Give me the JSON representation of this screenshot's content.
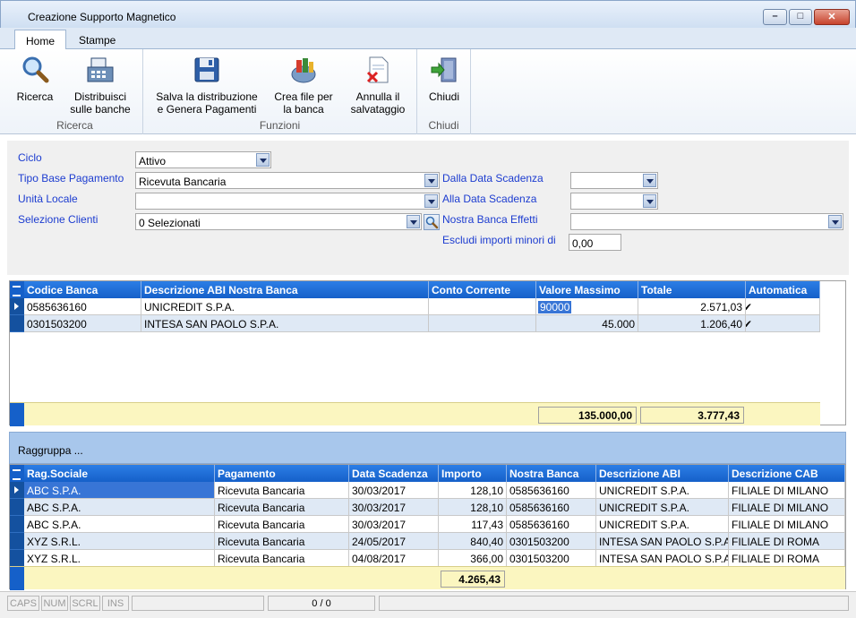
{
  "window": {
    "title": "Creazione Supporto Magnetico"
  },
  "ribbon": {
    "tabs": [
      "Home",
      "Stampe"
    ],
    "groups": [
      {
        "label": "Ricerca",
        "buttons": [
          "Ricerca",
          "Distribuisci sulle banche"
        ]
      },
      {
        "label": "Funzioni",
        "buttons": [
          "Salva la distribuzione e Genera Pagamenti",
          "Crea file per la banca",
          "Annulla il salvataggio"
        ]
      },
      {
        "label": "Chiudi",
        "buttons": [
          "Chiudi"
        ]
      }
    ],
    "btn_ricerca": "Ricerca",
    "btn_distribuisci_1": "Distribuisci",
    "btn_distribuisci_2": "sulle banche",
    "btn_salva_1": "Salva la distribuzione",
    "btn_salva_2": "e Genera Pagamenti",
    "btn_crea_1": "Crea file per",
    "btn_crea_2": "la banca",
    "btn_annulla_1": "Annulla il",
    "btn_annulla_2": "salvataggio",
    "btn_chiudi": "Chiudi",
    "group_ricerca": "Ricerca",
    "group_funzioni": "Funzioni",
    "group_chiudi": "Chiudi"
  },
  "filters": {
    "ciclo_label": "Ciclo",
    "ciclo_value": "Attivo",
    "tipo_label": "Tipo Base Pagamento",
    "tipo_value": "Ricevuta Bancaria",
    "unita_label": "Unità Locale",
    "unita_value": "",
    "clienti_label": "Selezione Clienti",
    "clienti_value": "0 Selezionati",
    "dalla_label": "Dalla Data Scadenza",
    "alla_label": "Alla Data Scadenza",
    "banca_label": "Nostra Banca Effetti",
    "escludi_label": "Escludi importi minori di",
    "escludi_value": "0,00"
  },
  "banks_grid": {
    "columns": [
      "Codice Banca",
      "Descrizione ABI Nostra Banca",
      "Conto Corrente",
      "Valore Massimo",
      "Totale",
      "Automatica"
    ],
    "rows": [
      {
        "codice": "0585636160",
        "descrizione": "UNICREDIT S.P.A.",
        "conto": "",
        "valore": "90000",
        "totale": "2.571,03",
        "automatica": "✔"
      },
      {
        "codice": "0301503200",
        "descrizione": "INTESA SAN PAOLO S.P.A.",
        "conto": "",
        "valore": "45.000",
        "totale": "1.206,40",
        "automatica": "✔"
      }
    ],
    "total_valore": "135.000,00",
    "total_totale": "3.777,43"
  },
  "group_bar": {
    "label": "Raggruppa ..."
  },
  "payments_grid": {
    "columns": [
      "Rag.Sociale",
      "Pagamento",
      "Data Scadenza",
      "Importo",
      "Nostra Banca",
      "Descrizione ABI",
      "Descrizione CAB"
    ],
    "rows": [
      {
        "rag": "ABC S.P.A.",
        "pag": "Ricevuta Bancaria",
        "data": "30/03/2017",
        "importo": "128,10",
        "banca": "0585636160",
        "abi": "UNICREDIT S.P.A.",
        "cab": "FILIALE DI MILANO"
      },
      {
        "rag": "ABC S.P.A.",
        "pag": "Ricevuta Bancaria",
        "data": "30/03/2017",
        "importo": "128,10",
        "banca": "0585636160",
        "abi": "UNICREDIT S.P.A.",
        "cab": "FILIALE DI MILANO"
      },
      {
        "rag": "ABC S.P.A.",
        "pag": "Ricevuta Bancaria",
        "data": "30/03/2017",
        "importo": "117,43",
        "banca": "0585636160",
        "abi": "UNICREDIT S.P.A.",
        "cab": "FILIALE DI MILANO"
      },
      {
        "rag": "XYZ S.R.L.",
        "pag": "Ricevuta Bancaria",
        "data": "24/05/2017",
        "importo": "840,40",
        "banca": "0301503200",
        "abi": "INTESA SAN PAOLO S.P.A",
        "cab": "FILIALE DI ROMA"
      },
      {
        "rag": "XYZ S.R.L.",
        "pag": "Ricevuta Bancaria",
        "data": "04/08/2017",
        "importo": "366,00",
        "banca": "0301503200",
        "abi": "INTESA SAN PAOLO S.P.A",
        "cab": "FILIALE DI ROMA"
      }
    ],
    "total_importo": "4.265,43"
  },
  "status": {
    "caps": "CAPS",
    "num": "NUM",
    "scrl": "SCRL",
    "ins": "INS",
    "records": "0 / 0"
  }
}
